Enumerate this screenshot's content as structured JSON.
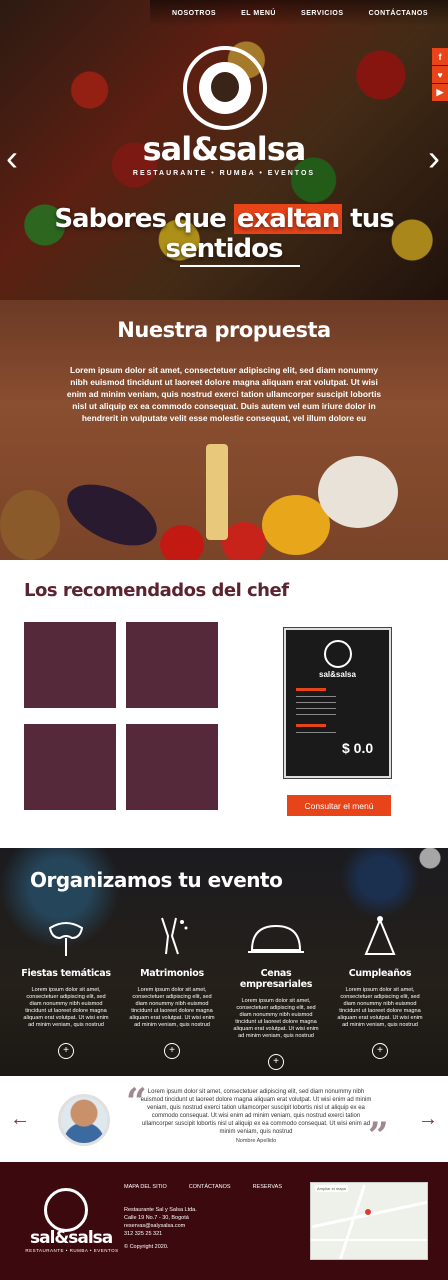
{
  "nav": [
    "NOSOTROS",
    "EL MENÚ",
    "SERVICIOS",
    "CONTÁCTANOS"
  ],
  "social": [
    "f",
    "♥",
    "▶"
  ],
  "hero": {
    "brand": "sal&salsa",
    "tagline": "RESTAURANTE • RUMBA • EVENTOS",
    "headline_pre": "Sabores que ",
    "headline_hl": "exaltan",
    "headline_post": " tus sentidos"
  },
  "propuesta": {
    "title": "Nuestra propuesta",
    "text": "Lorem ipsum dolor sit amet, consectetuer adipiscing elit, sed diam nonummy nibh euismod tincidunt ut laoreet dolore magna aliquam erat volutpat. Ut wisi enim ad minim veniam, quis nostrud exerci tation ullamcorper suscipit lobortis nisl ut aliquip ex ea commodo consequat. Duis autem vel eum iriure dolor in hendrerit in vulputate velit esse molestie consequat, vel illum dolore eu"
  },
  "chef": {
    "title": "Los recomendados del chef",
    "menu_title": "sal&salsa",
    "menu_price": "$ 0.0",
    "button": "Consultar el menú"
  },
  "eventos": {
    "title": "Organizamos tu evento",
    "items": [
      {
        "title": "Fiestas temáticas",
        "icon": "mask-icon",
        "text": "Lorem ipsum dolor sit amet, consectetuer adipiscing elit, sed diam nonummy nibh euismod tincidunt ut laoreet dolore magna aliquam erat volutpat. Ut wisi enim ad minim veniam, quis nostrud"
      },
      {
        "title": "Matrimonios",
        "icon": "champagne-icon",
        "text": "Lorem ipsum dolor sit amet, consectetuer adipiscing elit, sed diam nonummy nibh euismod tincidunt ut laoreet dolore magna aliquam erat volutpat. Ut wisi enim ad minim veniam, quis nostrud"
      },
      {
        "title": "Cenas empresariales",
        "icon": "roast-chicken-icon",
        "text": "Lorem ipsum dolor sit amet, consectetuer adipiscing elit, sed diam nonummy nibh euismod tincidunt ut laoreet dolore magna aliquam erat volutpat. Ut wisi enim ad minim veniam, quis nostrud"
      },
      {
        "title": "Cumpleaños",
        "icon": "party-hat-icon",
        "text": "Lorem ipsum dolor sit amet, consectetuer adipiscing elit, sed diam nonummy nibh euismod tincidunt ut laoreet dolore magna aliquam erat volutpat. Ut wisi enim ad minim veniam, quis nostrud"
      }
    ]
  },
  "testimonial": {
    "text": "Lorem ipsum dolor sit amet, consectetuer adipiscing elit, sed diam nonummy nibh euismod tincidunt ut laoreet dolore magna aliquam erat volutpat. Ut wisi enim ad minim veniam, quis nostrud exerci tation ullamcorper suscipit lobortis nisl ut aliquip ex ea commodo consequat. Ut wisi enim ad minim veniam, quis nostrud exerci tation ullamcorper suscipit lobortis nisl ut aliquip ex ea commodo consequat. Ut wisi enim ad minim veniam, quis nostrud",
    "author": "Nombre Apellido"
  },
  "footer": {
    "brand": "sal&salsa",
    "tagline": "RESTAURANTE • RUMBA • EVENTOS",
    "links": [
      "MAPA DEL SITIO",
      "CONTÁCTANOS",
      "RESERVAS"
    ],
    "address1": "Restaurante Sal y Salsa Ltda.",
    "address2": "Calle 19 No.7 - 30, Bogotá",
    "email": "reservas@salysalsa.com",
    "phone": "312 325 25 321",
    "copyright": "© Copyright 2020.",
    "map_label": "Ampliar el mapa"
  },
  "colors": {
    "accent": "#e8441a",
    "brand_dark": "#56293a",
    "footer": "#3c0a0e"
  }
}
